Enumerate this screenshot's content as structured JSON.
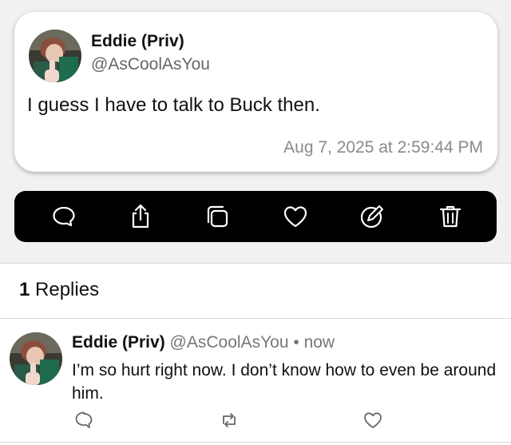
{
  "post": {
    "author_name": "Eddie (Priv)",
    "author_handle": "@AsCoolAsYou",
    "text": "I guess I have to talk to Buck then.",
    "timestamp": "Aug 7, 2025 at 2:59:44 PM",
    "avatar_icon": "avatar-photo"
  },
  "toolbar": {
    "background": "#000000",
    "icons": [
      "comment-icon",
      "share-icon",
      "copy-icon",
      "like-icon",
      "edit-icon",
      "delete-icon"
    ]
  },
  "replies_header": {
    "count": "1",
    "label": " Replies"
  },
  "reply": {
    "author_name": "Eddie (Priv)",
    "author_handle": "@AsCoolAsYou",
    "separator": "•",
    "time": "now",
    "text": "I’m so hurt right now. I don’t know how to even be around him.",
    "actions": [
      "comment-icon",
      "repost-icon",
      "like-icon"
    ]
  }
}
